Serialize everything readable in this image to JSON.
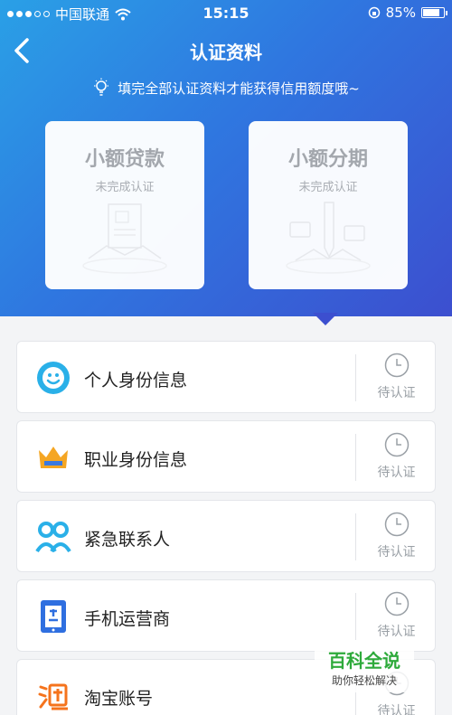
{
  "status_bar": {
    "carrier": "中国联通",
    "time": "15:15",
    "battery_percent": "85%",
    "battery_level": 0.85
  },
  "nav": {
    "title": "认证资料"
  },
  "tip": {
    "text": "填完全部认证资料才能获得信用额度哦~"
  },
  "cards": [
    {
      "title": "小额贷款",
      "subtitle": "未完成认证"
    },
    {
      "title": "小额分期",
      "subtitle": "未完成认证"
    }
  ],
  "verification_items": [
    {
      "label": "个人身份信息",
      "status": "待认证",
      "icon": "smile-icon",
      "color": "#2ab0e8"
    },
    {
      "label": "职业身份信息",
      "status": "待认证",
      "icon": "crown-icon",
      "color": "#f5a623"
    },
    {
      "label": "紧急联系人",
      "status": "待认证",
      "icon": "contacts-icon",
      "color": "#2ab0e8"
    },
    {
      "label": "手机运营商",
      "status": "待认证",
      "icon": "phone-carrier-icon",
      "color": "#2f6fe0"
    },
    {
      "label": "淘宝账号",
      "status": "待认证",
      "icon": "taobao-icon",
      "color": "#f5731c"
    }
  ],
  "watermark": {
    "title": "百科全说",
    "subtitle": "助你轻松解决"
  },
  "colors": {
    "hero_start": "#2aa0e6",
    "hero_end": "#3c4fcf",
    "status_gray": "#9aa0a6"
  }
}
